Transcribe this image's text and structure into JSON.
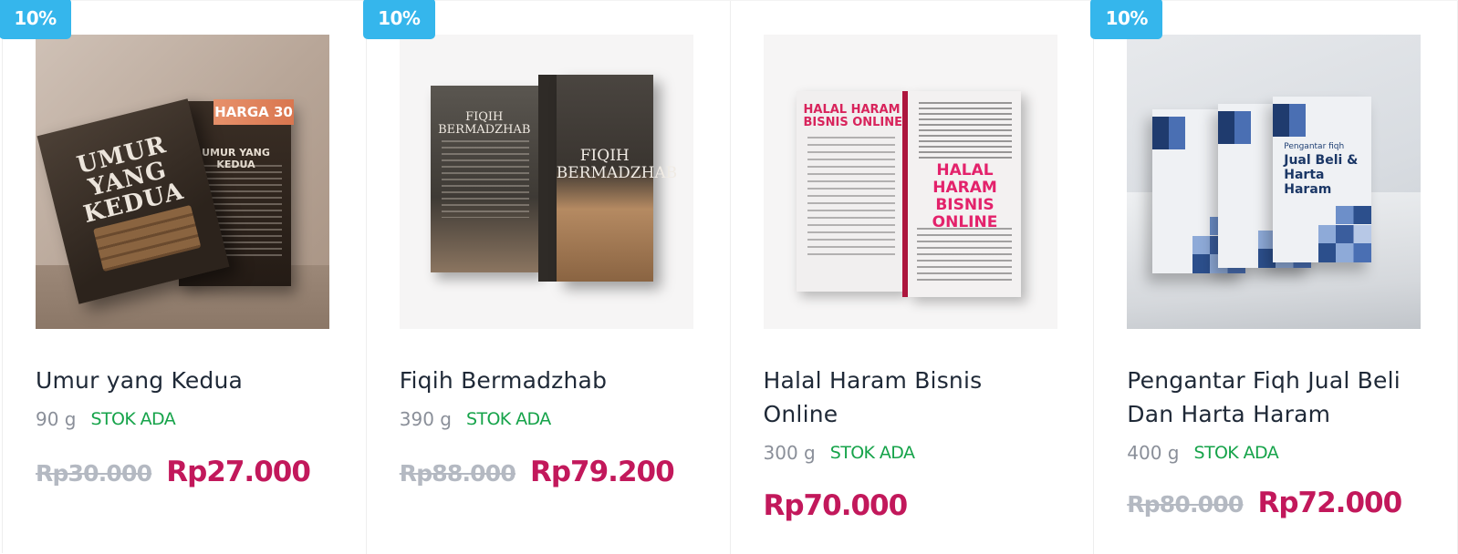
{
  "products": [
    {
      "badge": "10%",
      "title": "Umur yang Kedua",
      "weight": "90 g",
      "stock": "STOK ADA",
      "old_price": "Rp30.000",
      "price": "Rp27.000",
      "cover": {
        "title": "UMUR YANG KEDUA",
        "back_title": "UMUR YANG KEDUA",
        "tag": "HARGA 30"
      }
    },
    {
      "badge": "10%",
      "title": "Fiqih Bermadzhab",
      "weight": "390 g",
      "stock": "STOK ADA",
      "old_price": "Rp88.000",
      "price": "Rp79.200",
      "cover": {
        "title": "FIQIH BERMADZHAB"
      }
    },
    {
      "badge": "",
      "title": "Halal Haram Bisnis Online",
      "weight": "300 g",
      "stock": "STOK ADA",
      "old_price": "",
      "price": "Rp70.000",
      "cover": {
        "title": "HALAL HARAM BISNIS ONLINE",
        "back_title": "HALAL HARAM BISNIS ONLINE"
      }
    },
    {
      "badge": "10%",
      "title": "Pengantar Fiqh Jual Beli Dan Harta Haram",
      "weight": "400 g",
      "stock": "STOK ADA",
      "old_price": "Rp80.000",
      "price": "Rp72.000",
      "cover": {
        "small": "Pengantar fiqh",
        "title": "Jual Beli & Harta Haram"
      }
    }
  ],
  "colors": {
    "badge": "#35b6ec",
    "stock": "#16a34a",
    "price": "#c2185b",
    "old_price": "#b4b9c2"
  }
}
